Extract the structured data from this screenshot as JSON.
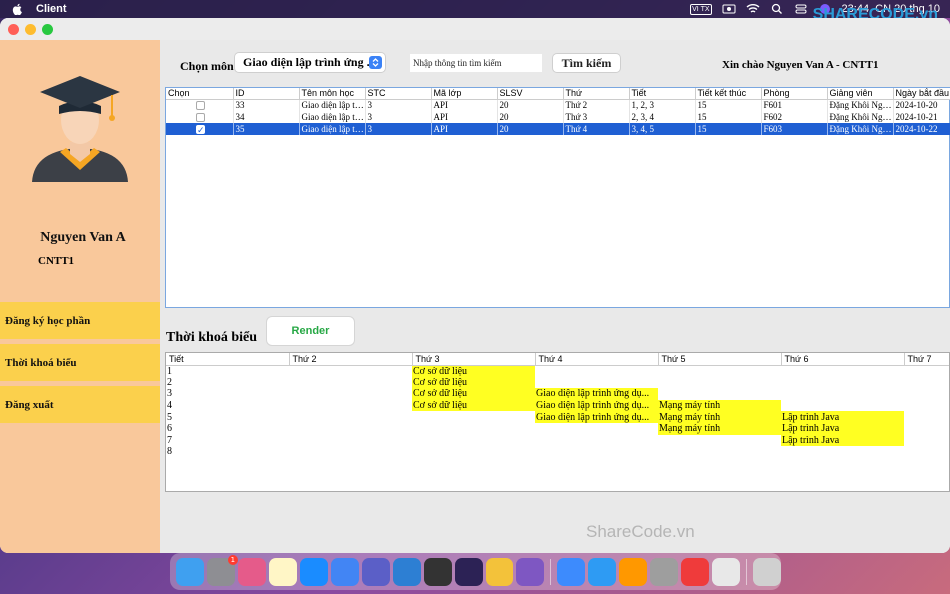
{
  "menubar": {
    "app_name": "Client",
    "input_badge": "VI TX",
    "clock": "23:44, CN 20 thg 10",
    "watermark": "SHARECODE.vn"
  },
  "sidebar": {
    "user_name": "Nguyen Van A",
    "user_class": "CNTT1",
    "items": [
      {
        "label": "Đăng ký học phần"
      },
      {
        "label": "Thời khoá biểu"
      },
      {
        "label": "Đăng xuất"
      }
    ]
  },
  "toolbar": {
    "subject_label": "Chọn môn",
    "subject_selected": "Giao diện lập trình ứng ...",
    "search_placeholder": "Nhập thông tin tìm kiếm",
    "search_button": "Tìm kiếm",
    "greeting": "Xin chào Nguyen Van A - CNTT1"
  },
  "course_table": {
    "columns": [
      "Chọn",
      "ID",
      "Tên môn học",
      "STC",
      "Mã lớp",
      "SLSV",
      "Thứ",
      "Tiết",
      "Tiết kết thúc",
      "Phòng",
      "Giảng viên",
      "Ngày bắt đầu"
    ],
    "rows": [
      {
        "checked": false,
        "selected": false,
        "cells": [
          "33",
          "Giao diện lập tri...",
          "3",
          "API",
          "20",
          "Thứ 2",
          "1, 2, 3",
          "15",
          "F601",
          "Đặng Khôi Ngu...",
          "2024-10-20"
        ]
      },
      {
        "checked": false,
        "selected": false,
        "cells": [
          "34",
          "Giao diện lập tri...",
          "3",
          "API",
          "20",
          "Thứ 3",
          "2, 3, 4",
          "15",
          "F602",
          "Đặng Khôi Ngu...",
          "2024-10-21"
        ]
      },
      {
        "checked": true,
        "selected": true,
        "cells": [
          "35",
          "Giao diện lập tri...",
          "3",
          "API",
          "20",
          "Thứ 4",
          "3, 4, 5",
          "15",
          "F603",
          "Đặng Khôi Ngu...",
          "2024-10-22"
        ]
      }
    ]
  },
  "schedule": {
    "title": "Thời khoá biểu",
    "render_button": "Render",
    "columns": [
      "Tiết",
      "Thứ 2",
      "Thứ 3",
      "Thứ 4",
      "Thứ 5",
      "Thứ 6",
      "Thứ 7"
    ],
    "rows": [
      [
        "1",
        "",
        "Cơ sở dữ liệu",
        "",
        "",
        "",
        ""
      ],
      [
        "2",
        "",
        "Cơ sở dữ liệu",
        "",
        "",
        "",
        ""
      ],
      [
        "3",
        "",
        "Cơ sở dữ liệu",
        "Giao diện lập trình ứng dụ...",
        "",
        "",
        ""
      ],
      [
        "4",
        "",
        "Cơ sở dữ liệu",
        "Giao diện lập trình ứng dụ...",
        "Mạng máy tính",
        "",
        ""
      ],
      [
        "5",
        "",
        "",
        "Giao diện lập trình ứng dụ...",
        "Mạng máy tính",
        "Lập trình Java",
        ""
      ],
      [
        "6",
        "",
        "",
        "",
        "Mạng máy tính",
        "Lập trình Java",
        ""
      ],
      [
        "7",
        "",
        "",
        "",
        "",
        "Lập trình Java",
        ""
      ],
      [
        "8",
        "",
        "",
        "",
        "",
        "",
        ""
      ]
    ],
    "highlight_color": "#ffff22"
  },
  "bottom_watermark": "ShareCode.vn",
  "colors": {
    "sidebar": "#f9c89b",
    "nav_button": "#fbd04c",
    "selection": "#1f5fd3",
    "render_text": "#27a845"
  },
  "dock": {
    "icons": [
      "finder-icon",
      "settings-icon",
      "launchpad-icon",
      "notes-icon",
      "appstore-icon",
      "chrome-icon",
      "teams-icon",
      "vscode-icon",
      "terminal-icon",
      "eclipse-icon",
      "chrome-canary-icon",
      "visual-studio-icon",
      "mail-icon",
      "safari-icon",
      "sublime-icon",
      "system-prefs-icon",
      "anydesk-icon",
      "java-icon",
      "trash-icon"
    ],
    "badge_count": "1"
  }
}
